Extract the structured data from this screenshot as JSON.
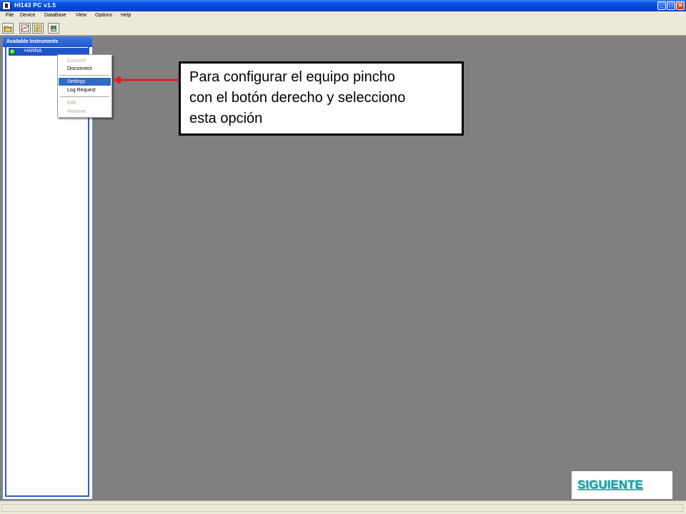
{
  "window": {
    "title": "HI143 PC v1.5"
  },
  "menubar": {
    "items": [
      "File",
      "Device",
      "DataBase",
      "View",
      "Options",
      "Help"
    ]
  },
  "toolbar": {
    "buttons": [
      "open-folder-icon",
      "chart-icon",
      "notepad-icon",
      "instrument-icon"
    ]
  },
  "sidebar": {
    "title": "Available Instruments",
    "instruments": [
      {
        "name": "HANNA",
        "status_color": "#1eb51e"
      }
    ]
  },
  "context_menu": {
    "items": [
      {
        "label": "Connect",
        "enabled": false
      },
      {
        "label": "Disconnect",
        "enabled": true
      },
      {
        "label": "Settings",
        "enabled": true,
        "highlighted": true
      },
      {
        "label": "Log Request",
        "enabled": true
      },
      {
        "label": "Edit",
        "enabled": false
      },
      {
        "label": "Remove",
        "enabled": false
      }
    ]
  },
  "callout": {
    "lines": [
      "Para configurar el equipo pincho",
      "con el botón derecho y selecciono",
      "esta opción"
    ]
  },
  "nav": {
    "next_label": "SIGUIENTE"
  },
  "colors": {
    "titlebar": "#0a55e0",
    "workspace": "#808080",
    "arrow": "#e02020",
    "highlight": "#316ac5",
    "next_link": "#15a5a8"
  }
}
